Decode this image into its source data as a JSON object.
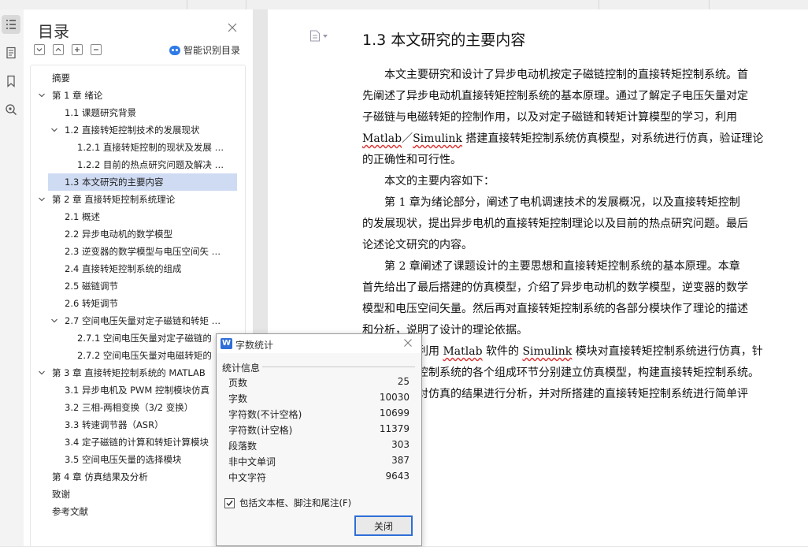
{
  "nav": {
    "title": "目录",
    "smart_label": "智能识别目录",
    "items": [
      {
        "text": "摘要",
        "level": 0,
        "twisty": false
      },
      {
        "text": "第 1 章  绪论",
        "level": 0,
        "twisty": true
      },
      {
        "text": "1.1  课题研究背景",
        "level": 1,
        "twisty": false
      },
      {
        "text": "1.2 直接转矩控制技术的发展现状",
        "level": 1,
        "twisty": true
      },
      {
        "text": "1.2.1 直接转矩控制的现状及发展 …",
        "level": 2,
        "twisty": false
      },
      {
        "text": "1.2.2 目前的热点研究问题及解决 …",
        "level": 2,
        "twisty": false
      },
      {
        "text": "1.3 本文研究的主要内容",
        "level": 1,
        "twisty": false,
        "selected": true
      },
      {
        "text": "第 2 章  直接转矩控制系统理论",
        "level": 0,
        "twisty": true
      },
      {
        "text": "2.1 概述",
        "level": 1,
        "twisty": false
      },
      {
        "text": "2.2  异步电动机的数学模型",
        "level": 1,
        "twisty": false
      },
      {
        "text": "2.3  逆变器的数学模型与电压空间矢 …",
        "level": 1,
        "twisty": false
      },
      {
        "text": "2.4 直接转矩控制系统的组成",
        "level": 1,
        "twisty": false
      },
      {
        "text": "2.5  磁链调节",
        "level": 1,
        "twisty": false
      },
      {
        "text": "2.6  转矩调节",
        "level": 1,
        "twisty": false
      },
      {
        "text": "2.7  空间电压矢量对定子磁链和转矩 …",
        "level": 1,
        "twisty": true
      },
      {
        "text": "2.7.1  空间电压矢量对定子磁链的",
        "level": 2,
        "twisty": false
      },
      {
        "text": "2.7.2 空间电压矢量对电磁转矩的",
        "level": 2,
        "twisty": false
      },
      {
        "text": "第 3 章  直接转矩控制系统的 MATLAB",
        "level": 0,
        "twisty": true
      },
      {
        "text": "3.1 异步电机及 PWM 控制模块仿真",
        "level": 1,
        "twisty": false
      },
      {
        "text": "3.2 三相-两相变换（3/2 变换）",
        "level": 1,
        "twisty": false
      },
      {
        "text": "3.3 转速调节器（ASR）",
        "level": 1,
        "twisty": false
      },
      {
        "text": "3.4 定子磁链的计算和转矩计算模块",
        "level": 1,
        "twisty": false
      },
      {
        "text": "3.5 空间电压矢量的选择模块",
        "level": 1,
        "twisty": false
      },
      {
        "text": "第 4 章  仿真结果及分析",
        "level": 0,
        "twisty": false
      },
      {
        "text": "致谢",
        "level": 0,
        "twisty": false
      },
      {
        "text": "参考文献",
        "level": 0,
        "twisty": false
      }
    ]
  },
  "doc": {
    "heading": "1.3 本文研究的主要内容",
    "lines": [
      "　　本文主要研究和设计了异步电动机按定子磁链控制的直接转矩控制系统。首",
      "先阐述了异步电动机直接转矩控制系统的基本原理。通过了解定子电压矢量对定",
      "子磁链与电磁转矩的控制作用，以及对定子磁链和转矩计算模型的学习，利用",
      "__WAVY__",
      "的正确性和可行性。",
      "　　本文的主要内容如下：",
      "　　第 1 章为绪论部分，阐述了电机调速技术的发展概况，以及直接转矩控制",
      "的发展现状，提出异步电机的直接转矩控制理论以及目前的热点研究问题。最后",
      "论述论文研究的内容。",
      "　　第 2 章阐述了课题设计的主要思想和直接转矩控制系统的基本原理。本章",
      "首先给出了最后搭建的仿真模型，介绍了异步电动机的数学模型，逆变器的数学",
      "模型和电压空间矢量。然后再对直接转矩控制系统的各部分模块作了理论的描述",
      "和分析，说明了设计的理论依据。",
      "　　　　章利用  __M2__ 软件的 __S2__ 模块对直接转矩控制系统进行仿真，针",
      "　　　　矩控制系统的各个组成环节分别建立仿真模型，构建直接转矩控制系统。",
      "　　　　章对仿真的结果进行分析，并对所搭建的直接转矩控制系统进行简单评"
    ],
    "line4": {
      "matlab": "Matlab",
      "slash": "／",
      "simulink": "Simulink",
      "rest": " 搭建直接转矩控制系统仿真模型，对系统进行仿真，验证理论"
    },
    "line13": {
      "matlab": "Matlab",
      "simulink": "Simulink"
    }
  },
  "dialog": {
    "title": "字数统计",
    "group_label": "统计信息",
    "stats": [
      {
        "label": "页数",
        "value": "25"
      },
      {
        "label": "字数",
        "value": "10030"
      },
      {
        "label": "字符数(不计空格)",
        "value": "10699"
      },
      {
        "label": "字符数(计空格)",
        "value": "11379"
      },
      {
        "label": "段落数",
        "value": "303"
      },
      {
        "label": "非中文单词",
        "value": "387"
      },
      {
        "label": "中文字符",
        "value": "9643"
      }
    ],
    "checkbox_label": "包括文本框、脚注和尾注(F)",
    "checkbox_checked": true,
    "close_label": "关闭"
  },
  "colors": {
    "accent": "#2f6ed8",
    "selection": "#cfdbf3",
    "spellcheck": "#d33333"
  }
}
